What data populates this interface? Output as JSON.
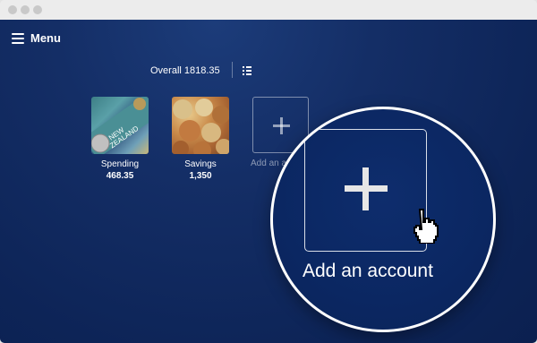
{
  "window": {
    "controls": [
      "close",
      "minimize",
      "maximize"
    ]
  },
  "header": {
    "menu_label": "Menu",
    "menu_icon": "hamburger-icon"
  },
  "summary": {
    "overall_label": "Overall 1818.35",
    "view_toggle_icon": "list-view-icon"
  },
  "accounts": [
    {
      "name": "Spending",
      "value": "468.35",
      "image": "new-zealand-banknotes"
    },
    {
      "name": "Savings",
      "value": "1,350",
      "image": "coins"
    }
  ],
  "add_account": {
    "label_small": "Add an account",
    "label": "Add an account",
    "icon": "plus-icon"
  },
  "cursor": {
    "icon": "hand-pointer-icon"
  },
  "banknote": {
    "line1": "NEW",
    "line2": "ZEALAND"
  }
}
